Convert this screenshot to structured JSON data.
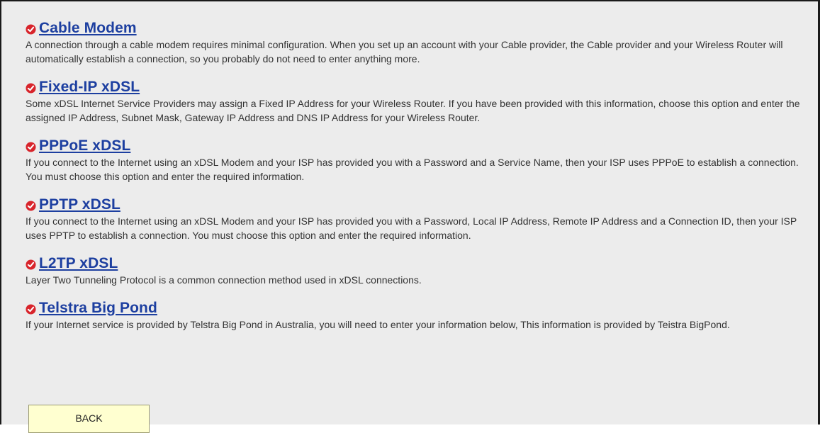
{
  "options": [
    {
      "title": "Cable Modem",
      "description": "A connection through a cable modem requires minimal configuration. When you set up an account with your Cable provider, the Cable provider and your Wireless Router will automatically establish a connection, so you probably do not need to enter anything more."
    },
    {
      "title": "Fixed-IP xDSL",
      "description": "Some xDSL Internet Service Providers may assign a Fixed IP Address for your Wireless Router. If you have been provided with this information, choose this option and enter the assigned IP Address, Subnet Mask, Gateway IP Address and DNS IP Address for your Wireless Router."
    },
    {
      "title": "PPPoE xDSL",
      "description": "If you connect to the Internet using an xDSL Modem and your ISP has provided you with a Password and a Service Name, then your ISP uses PPPoE to establish a connection. You must choose this option and enter the required information."
    },
    {
      "title": "PPTP xDSL",
      "description": "If you connect to the Internet using an xDSL Modem and your ISP has provided you with a Password, Local IP Address, Remote IP Address and a Connection ID, then your ISP uses PPTP to establish a connection. You must choose this option and enter the required information."
    },
    {
      "title": "L2TP xDSL",
      "description": "Layer Two Tunneling Protocol is a common connection method used in xDSL connections."
    },
    {
      "title": "Telstra Big Pond",
      "description": "If your Internet service is provided by Telstra Big Pond in Australia, you will need to enter your information below, This information is provided by Teistra BigPond."
    }
  ],
  "back_button": {
    "label": "BACK"
  },
  "icons": {
    "bullet": "red-check-circle-icon"
  },
  "colors": {
    "link": "#1d3fa0",
    "bullet": "#d8242b",
    "button_bg": "#ffffd0",
    "background": "#ececec"
  }
}
